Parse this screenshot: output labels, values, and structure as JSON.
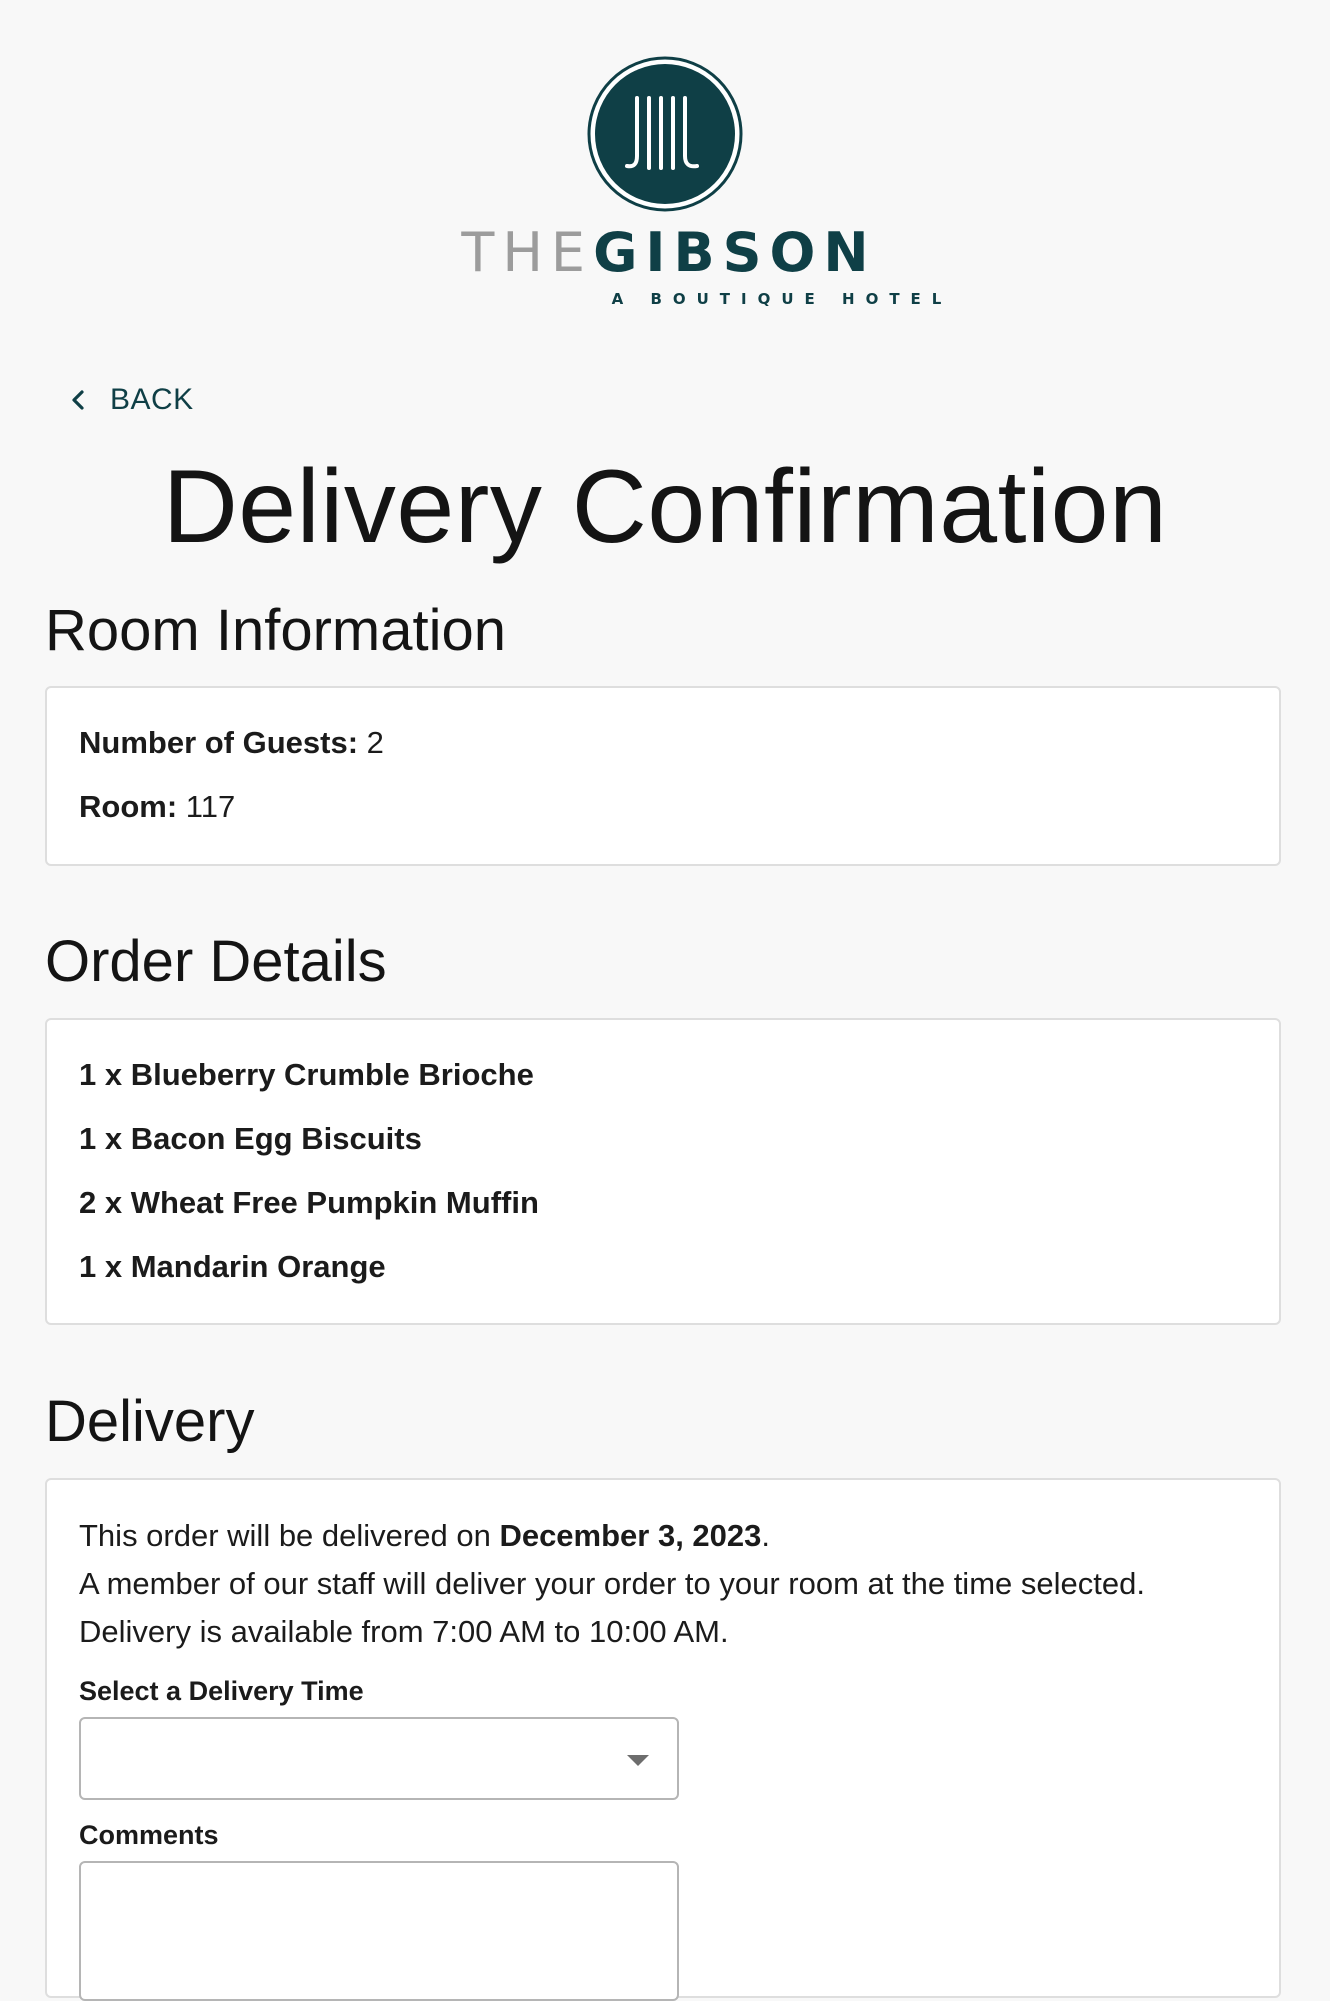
{
  "brand": {
    "the": "THE",
    "gibson": "GIBSON",
    "tagline": "A BOUTIQUE HOTEL",
    "primary_color": "#0f3f46",
    "secondary_color": "#9c9c9c"
  },
  "nav": {
    "back_label": "BACK",
    "back_icon": "chevron-left-icon"
  },
  "page": {
    "title": "Delivery Confirmation"
  },
  "room_info": {
    "heading": "Room Information",
    "guests_label": "Number of Guests:",
    "guests_value": "2",
    "room_label": "Room:",
    "room_value": "117"
  },
  "order": {
    "heading": "Order Details",
    "items": [
      "1 x Blueberry Crumble Brioche",
      "1 x Bacon Egg Biscuits",
      "2 x Wheat Free Pumpkin Muffin",
      "1 x Mandarin Orange"
    ]
  },
  "delivery": {
    "heading": "Delivery",
    "line1_prefix": "This order will be delivered on ",
    "line1_date": "December 3, 2023",
    "line1_suffix": ".",
    "line2": "A member of our staff will deliver your order to your room at the time selected.",
    "line3": "Delivery is available from 7:00 AM to 10:00 AM.",
    "time_label": "Select a Delivery Time",
    "time_value": "",
    "comments_label": "Comments",
    "comments_value": ""
  }
}
